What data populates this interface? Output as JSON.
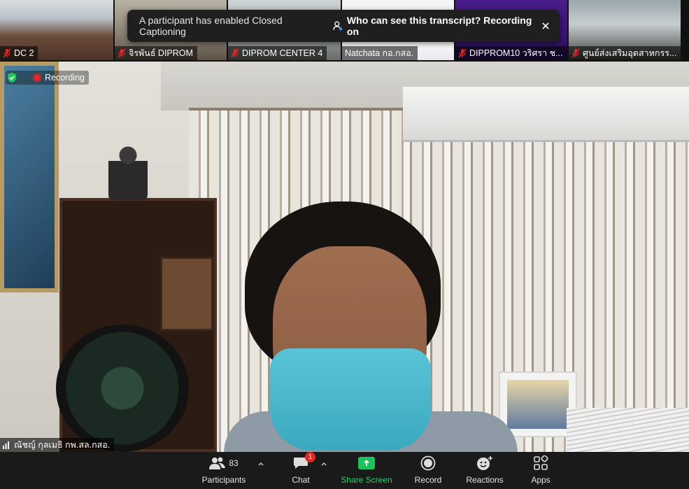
{
  "thumbnails": [
    {
      "name": "DC 2"
    },
    {
      "name": "จิรพันธ์ DIPROM"
    },
    {
      "name": "DIPROM CENTER 4"
    },
    {
      "name": "Natchata กอ.กสอ."
    },
    {
      "name": "DIPPROM10 วริศรา ช..."
    },
    {
      "name": "ศูนย์ส่งเสริมอุตสาหกรร..."
    }
  ],
  "toast": {
    "message": "A participant has enabled Closed Captioning",
    "link": "Who can see this transcript? Recording on"
  },
  "recording": {
    "label": "Recording"
  },
  "speaker": {
    "name": "ณัชญ์ กุลเมธิ กพ.สล.กสอ."
  },
  "toolbar": {
    "participants_label": "Participants",
    "participants_count": "83",
    "chat_label": "Chat",
    "chat_badge": "1",
    "share_label": "Share Screen",
    "record_label": "Record",
    "reactions_label": "Reactions",
    "apps_label": "Apps"
  },
  "colors": {
    "share": "#1ec15c",
    "recording": "#e02828",
    "badge": "#e02828",
    "shield": "#22c55e"
  }
}
